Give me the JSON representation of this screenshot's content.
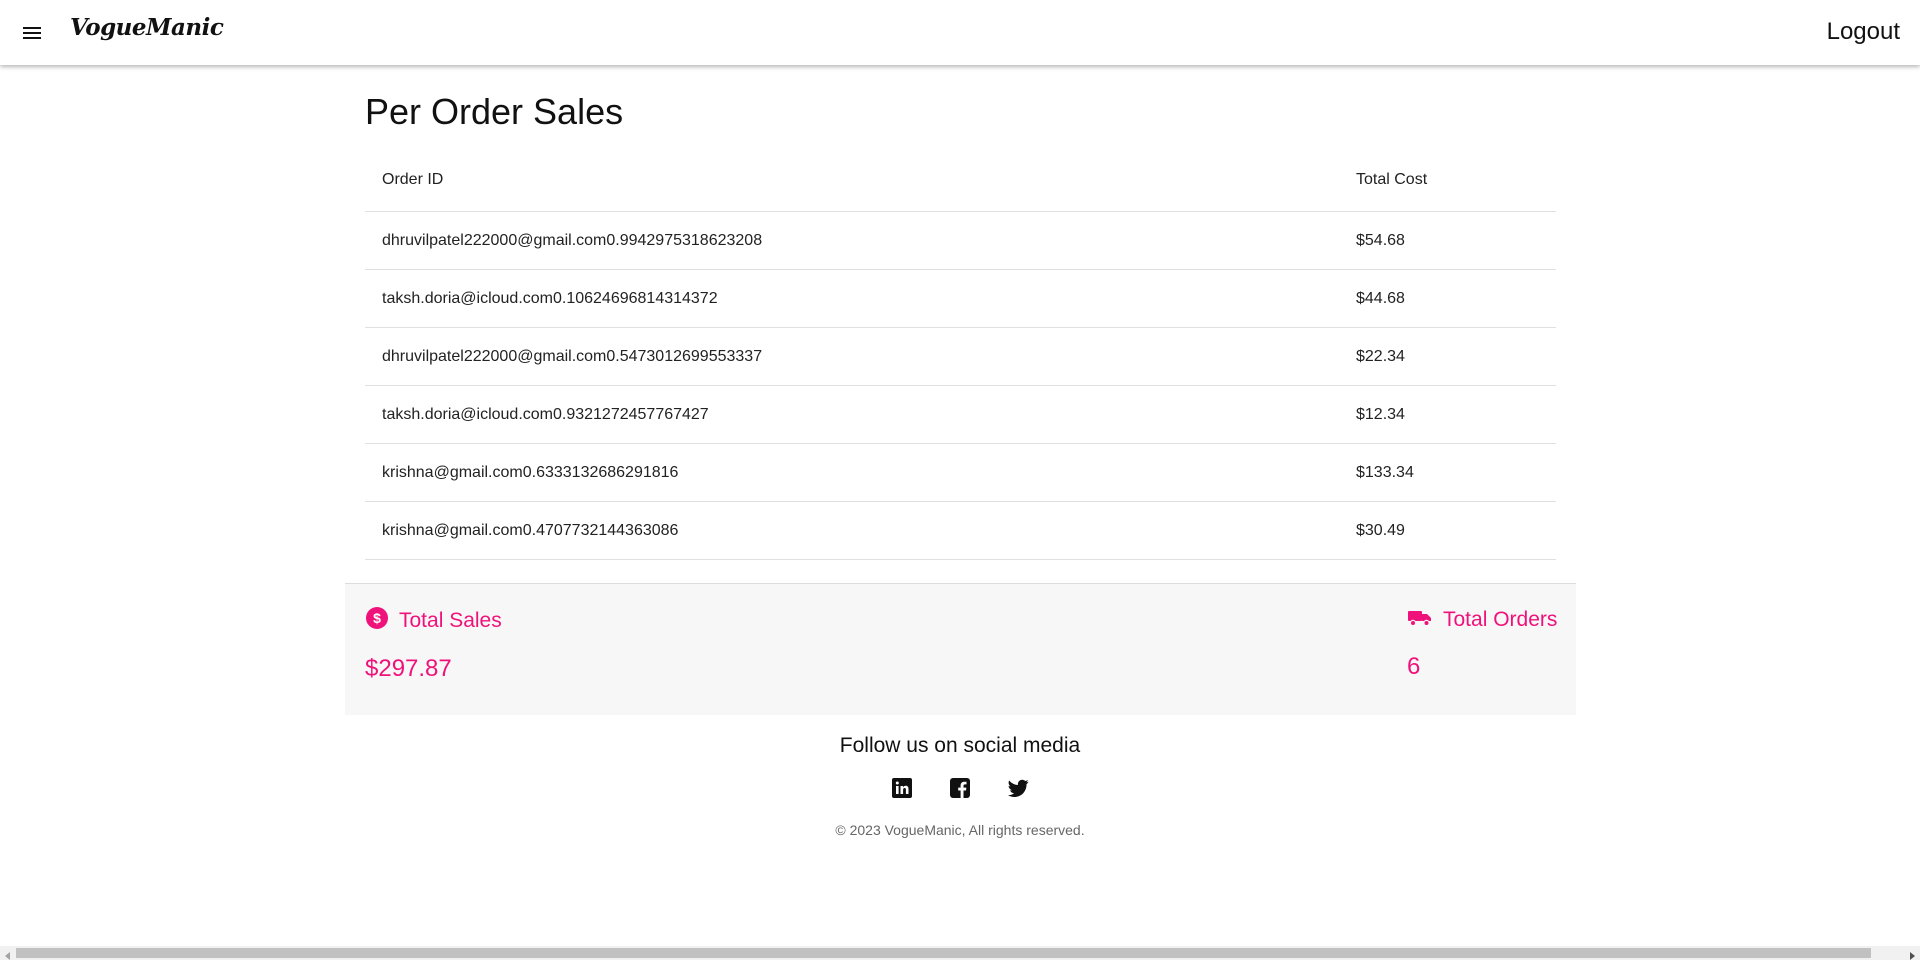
{
  "header": {
    "brand": "VogueManic",
    "logout_label": "Logout"
  },
  "main": {
    "title": "Per Order Sales",
    "table": {
      "columns": [
        "Order ID",
        "Total Cost"
      ],
      "rows": [
        {
          "order_id": "dhruvilpatel222000@gmail.com0.9942975318623208",
          "total_cost": "$54.68"
        },
        {
          "order_id": "taksh.doria@icloud.com0.10624696814314372",
          "total_cost": "$44.68"
        },
        {
          "order_id": "dhruvilpatel222000@gmail.com0.5473012699553337",
          "total_cost": "$22.34"
        },
        {
          "order_id": "taksh.doria@icloud.com0.9321272457767427",
          "total_cost": "$12.34"
        },
        {
          "order_id": "krishna@gmail.com0.6333132686291816",
          "total_cost": "$133.34"
        },
        {
          "order_id": "krishna@gmail.com0.4707732144363086",
          "total_cost": "$30.49"
        }
      ]
    }
  },
  "summary": {
    "total_sales_label": "Total Sales",
    "total_sales_value": "$297.87",
    "total_orders_label": "Total Orders",
    "total_orders_value": "6",
    "accent_color": "#f0127b"
  },
  "footer": {
    "follow_text": "Follow us on social media",
    "social_icons": [
      "linkedin-icon",
      "facebook-icon",
      "twitter-icon"
    ],
    "copyright": "© 2023 VogueManic, All rights reserved."
  }
}
